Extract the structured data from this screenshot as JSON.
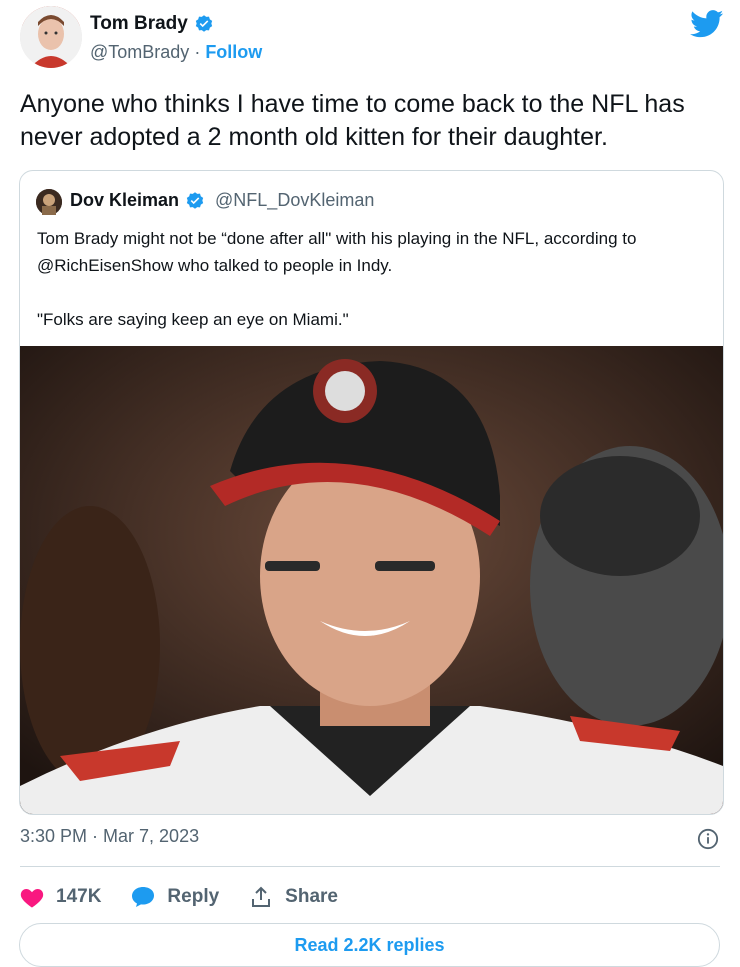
{
  "author": {
    "display_name": "Tom Brady",
    "handle": "@TomBrady",
    "separator": " · ",
    "follow_label": "Follow"
  },
  "tweet": {
    "text": "Anyone who thinks I have time to come back to the NFL has never adopted a 2 month old kitten for their daughter."
  },
  "quoted": {
    "display_name": "Dov Kleiman",
    "handle": "@NFL_DovKleiman",
    "text": "Tom Brady might not be “done after all\" with his playing in the NFL, according to @RichEisenShow who talked to people in Indy.\n\n\"Folks are saying keep an eye on Miami.\""
  },
  "meta": {
    "timestamp": "3:30 PM · Mar 7, 2023"
  },
  "actions": {
    "likes": "147K",
    "reply_label": "Reply",
    "share_label": "Share",
    "read_replies_label": "Read 2.2K replies"
  },
  "colors": {
    "accent": "#1d9bf0",
    "like": "#f91880",
    "secondary_text": "#536471"
  },
  "icons": [
    "verified-badge-icon",
    "twitter-bird-icon",
    "info-icon",
    "heart-icon",
    "reply-bubble-icon",
    "share-icon"
  ]
}
